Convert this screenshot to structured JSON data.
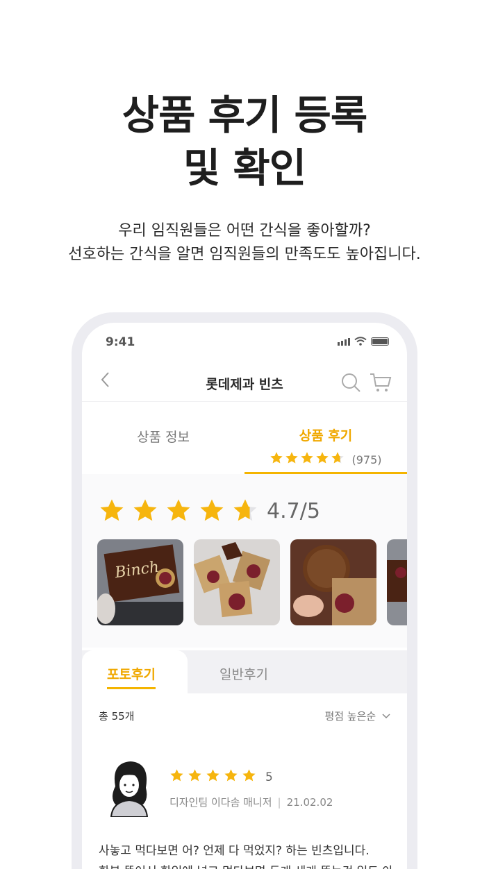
{
  "headline": {
    "line1": "상품 후기 등록",
    "line2": "및 확인"
  },
  "subline": {
    "line1": "우리 임직원들은 어떤 간식을 좋아할까?",
    "line2": "선호하는 간식을 알면 임직원들의 만족도도 높아집니다."
  },
  "status": {
    "time": "9:41"
  },
  "nav": {
    "back_icon": "chevron-left-icon",
    "title": "롯데제과 빈츠",
    "search_icon": "search-icon",
    "cart_icon": "cart-icon"
  },
  "tabs": {
    "info_label": "상품 정보",
    "review_label": "상품 후기",
    "review_count": "(975)",
    "rating_value": 4.7
  },
  "rating": {
    "score_text": "4.7/5",
    "value": 4.7,
    "max": 5,
    "star_color": "#f6b50e"
  },
  "photos": [
    {
      "alt": "빈츠 상자"
    },
    {
      "alt": "빈츠 개별 포장"
    },
    {
      "alt": "빈츠 과자"
    },
    {
      "alt": "빈츠"
    }
  ],
  "subtabs": {
    "photo_label": "포토후기",
    "general_label": "일반후기"
  },
  "list": {
    "total": "총 55개",
    "sort": "평점 높은순",
    "sort_icon": "chevron-down-icon"
  },
  "review": {
    "stars": 5,
    "score": "5",
    "author": "디자인팀 이다솜 매니저",
    "date": "21.02.02",
    "line1": "사놓고 먹다보면 어? 언제 다 먹었지? 하는 빈츠입니다.",
    "line2": "한봉 뜯어서 한입에 넣고 먹다보면 두개 세개 뜯는건 일도 아"
  },
  "colors": {
    "accent": "#f4b400",
    "accent_text": "#f0a800"
  }
}
